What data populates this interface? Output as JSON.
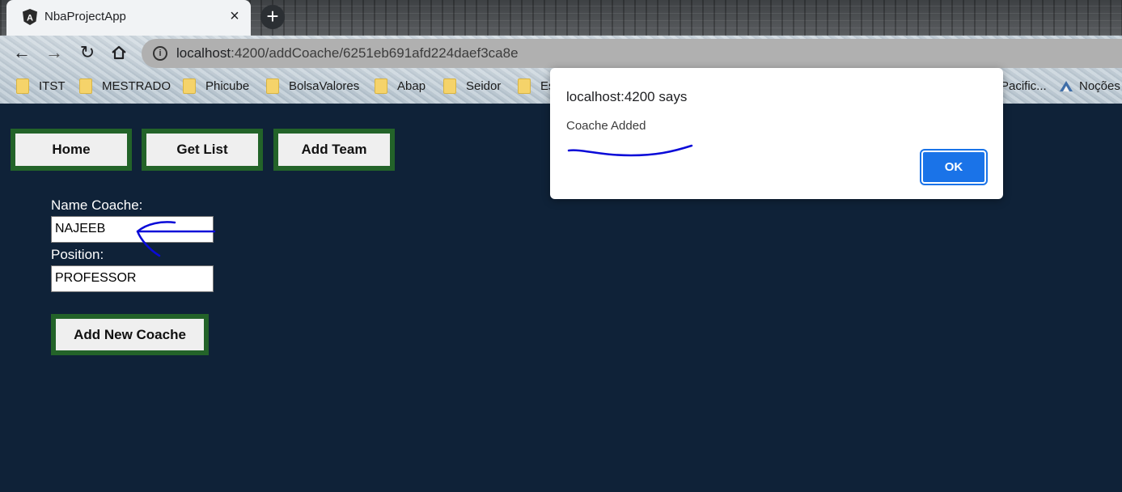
{
  "browser": {
    "tab_title": "NbaProjectApp",
    "tab_close": "×",
    "new_tab": "+",
    "url_host": "localhost",
    "url_path": ":4200/addCoache/6251eb691afd224daef3ca8e",
    "bookmarks": [
      {
        "label": "ITST",
        "icon": "folder-icon"
      },
      {
        "label": "MESTRADO",
        "icon": "folder-icon"
      },
      {
        "label": "Phicube",
        "icon": "folder-icon"
      },
      {
        "label": "BolsaValores",
        "icon": "folder-icon"
      },
      {
        "label": "Abap",
        "icon": "folder-icon"
      },
      {
        "label": "Seidor",
        "icon": "folder-icon"
      },
      {
        "label": "Es",
        "icon": "folder-icon"
      },
      {
        "label": "Pacific...",
        "icon": ""
      },
      {
        "label": "Noções",
        "icon": "mountain-icon"
      }
    ]
  },
  "nav": {
    "home": "Home",
    "get_list": "Get List",
    "add_team": "Add Team"
  },
  "form": {
    "name_label": "Name Coache:",
    "name_value": "NAJEEB",
    "position_label": "Position:",
    "position_value": "PROFESSOR",
    "submit_label": "Add New Coache"
  },
  "alert": {
    "title": "localhost:4200 says",
    "message": "Coache Added",
    "ok_label": "OK"
  },
  "colors": {
    "page_bg": "#0f2238",
    "button_border": "#236329",
    "ok_button": "#1a73e8",
    "annotation_ink": "#0a0ad8"
  }
}
